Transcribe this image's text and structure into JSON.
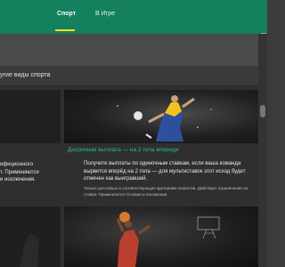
{
  "topbar": {
    "tabs": [
      {
        "label": "Спорт",
        "active": true
      },
      {
        "label": "В Игре",
        "active": false
      }
    ],
    "accent": "#ffdf1b",
    "bg": "#14805e"
  },
  "filter": {
    "label": "угие виды спорта"
  },
  "cards": [
    {
      "title": "Досрочная выплата — на 2 гола впереди",
      "description": "Получите выплаты по одиночным ставкам, если ваша команда вырвется вперёд на 2 гола — для мультиставок этот исход будет отмечен как выигравший.",
      "terms": "Только для новых и соответствующих критериям клиентов. Действует ограничение на ставки. Применяются Условия и положения."
    }
  ],
  "left_card": {
    "lines": [
      "ифиционного",
      "т. Применяются",
      "и исключения."
    ]
  }
}
